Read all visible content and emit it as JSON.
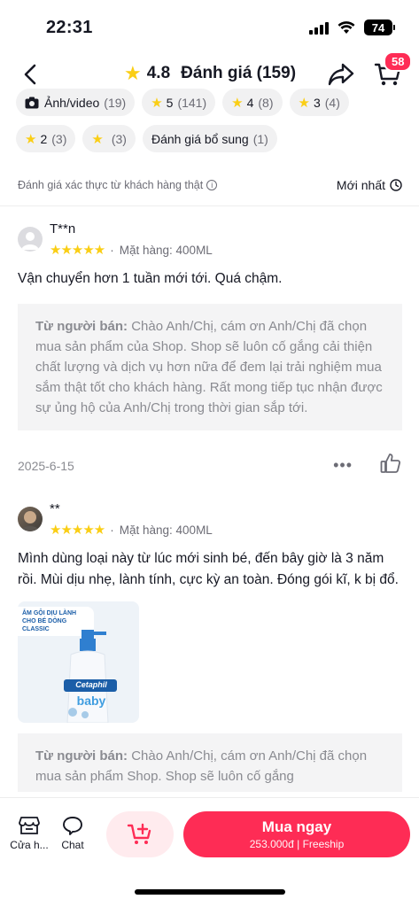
{
  "status": {
    "time": "22:31",
    "battery": "74"
  },
  "header": {
    "rating": "4.8",
    "title": "Đánh giá (159)",
    "cart_count": "58"
  },
  "filters": {
    "row1": [
      {
        "label": "Ảnh/video",
        "count": "(19)",
        "icon": "camera-icon"
      },
      {
        "label": "5",
        "count": "(141)",
        "icon": "star-icon"
      },
      {
        "label": "4",
        "count": "(8)",
        "icon": "star-icon"
      },
      {
        "label": "3",
        "count": "(4)",
        "icon": "star-icon"
      }
    ],
    "row2": [
      {
        "label": "2",
        "count": "(3)",
        "icon": "star-icon"
      },
      {
        "label": "",
        "count": "(3)",
        "icon": "star-icon"
      },
      {
        "label": "Đánh giá bổ sung",
        "count": "(1)"
      }
    ]
  },
  "verified_text": "Đánh giá xác thực từ khách hàng thật",
  "sort_label": "Mới nhất",
  "reviews": [
    {
      "name": "T**n",
      "stars": "★★★★★",
      "variant": "Mặt hàng: 400ML",
      "text": "Vận chuyển hơn 1 tuần mới tới. Quá chậm.",
      "seller_label": "Từ người bán:",
      "seller_reply": "Chào Anh/Chị, cám ơn Anh/Chị đã chọn mua sản phẩm của Shop. Shop sẽ luôn cố gắng cải thiện chất lượng và dịch vụ hơn nữa để đem lại trải nghiệm mua sắm thật tốt cho khách hàng. Rất mong tiếp tục nhận được sự ủng hộ của Anh/Chị trong thời gian sắp tới.",
      "date": "2025-6-15"
    },
    {
      "name": "**",
      "stars": "★★★★★",
      "variant": "Mặt hàng: 400ML",
      "text": "Mình dùng loại này từ lúc mới sinh bé, đến bây giờ là 3 năm rồi. Mùi dịu nhẹ, lành tính, cực kỳ an toàn. Đóng gói kĩ, k bị đổ.",
      "image_caption": "ẮM GỘI DỊU LÀNH CHO BÉ DÒNG CLASSIC",
      "image_brand": "Cetaphil",
      "image_product": "baby",
      "seller_label": "Từ người bán:",
      "seller_reply": "Chào Anh/Chị, cám ơn Anh/Chị đã chọn mua sản phẩm Shop. Shop sẽ luôn cố gắng"
    }
  ],
  "bottom": {
    "shop_label": "Cửa h...",
    "chat_label": "Chat",
    "buy_label": "Mua ngay",
    "price": "253.000đ",
    "shipping": "Freeship"
  },
  "colors": {
    "accent": "#FE2C55",
    "star": "#FACE15"
  }
}
